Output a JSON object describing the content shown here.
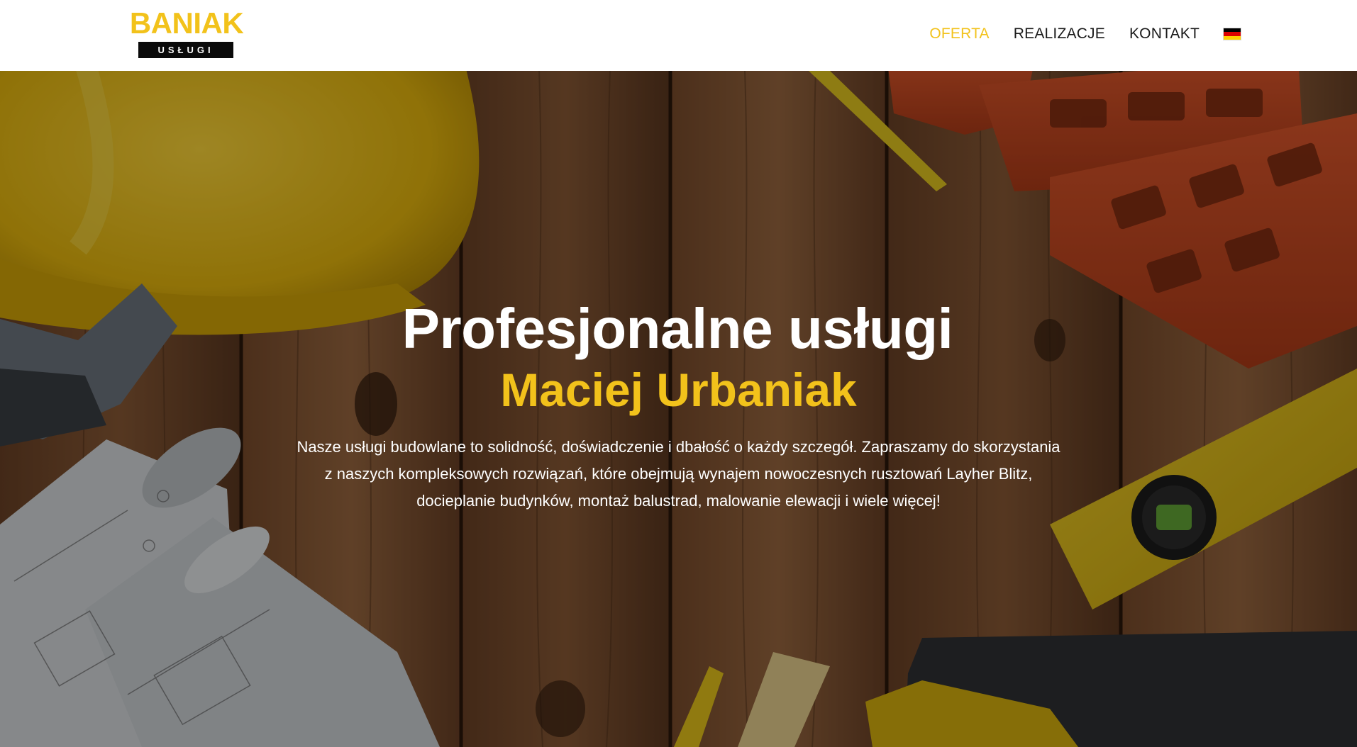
{
  "header": {
    "logo": {
      "top": "BANIAK",
      "bottom": "USŁUGI"
    },
    "nav": [
      {
        "label": "OFERTA",
        "active": true
      },
      {
        "label": "REALIZACJE",
        "active": false
      },
      {
        "label": "KONTAKT",
        "active": false
      }
    ],
    "language_flag": {
      "icon": "german-flag-icon",
      "colors": [
        "#000000",
        "#dd0000",
        "#ffce00"
      ]
    }
  },
  "hero": {
    "title": "Profesjonalne usługi",
    "subtitle": "Maciej Urbaniak",
    "text_lines": [
      "Nasze usługi budowlane to solidność, doświadczenie i dbałość o każdy szczegół. Zapraszamy do skorzystania",
      "z naszych kompleksowych rozwiązań, które obejmują wynajem nowoczesnych rusztowań Layher Blitz,",
      "docieplanie budynków, montaż balustrad, malowanie elewacji i wiele więcej!"
    ]
  },
  "colors": {
    "accent": "#f2c21b",
    "nav_text": "#1a1a1a",
    "hero_text": "#ffffff"
  }
}
